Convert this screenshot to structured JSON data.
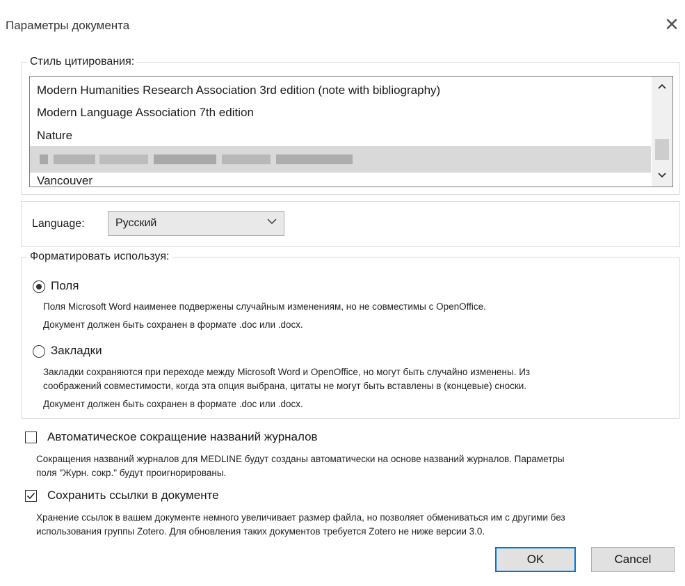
{
  "window": {
    "title": "Параметры документа",
    "close_icon": "close-icon"
  },
  "citation": {
    "legend": "Стиль цитирования:",
    "items": [
      "Modern Humanities Research Association 3rd edition (note with bibliography)",
      "Modern Language Association 7th edition",
      "Nature",
      "Vancouver"
    ],
    "selected_item_blurred": true
  },
  "language": {
    "label": "Language:",
    "value": "Русский"
  },
  "format": {
    "legend": "Форматировать используя:",
    "fields": {
      "label": "Поля",
      "selected": true,
      "desc1": "Поля Microsoft Word наименее подвержены случайным изменениям, но не совместимы с OpenOffice.",
      "desc2": "Документ должен быть сохранен в формате .doc или .docx."
    },
    "bookmarks": {
      "label": "Закладки",
      "selected": false,
      "desc1": "Закладки сохраняются при переходе между Microsoft Word и OpenOffice, но могут быть случайно изменены. Из",
      "desc2": "соображений совместимости, когда эта опция выбрана, цитаты не могут быть вставлены в (концевые) сноски.",
      "desc3": "Документ должен быть сохранен в формате .doc или .docx."
    }
  },
  "abbrev": {
    "label": "Автоматическое сокращение названий журналов",
    "checked": false,
    "desc1": "Сокращения названий журналов для MEDLINE будут созданы автоматически на основе названий журналов. Параметры",
    "desc2": "поля \"Журн. сокр.\" будут проигнорированы."
  },
  "store": {
    "label": "Сохранить ссылки в документе",
    "checked": true,
    "desc1": "Хранение ссылок в вашем документе немного увеличивает размер файла, но позволяет обмениваться им с другими без",
    "desc2": "использования группы Zotero. Для обновления таких документов требуется Zotero не ниже версии 3.0."
  },
  "buttons": {
    "ok": "OK",
    "cancel": "Cancel"
  }
}
